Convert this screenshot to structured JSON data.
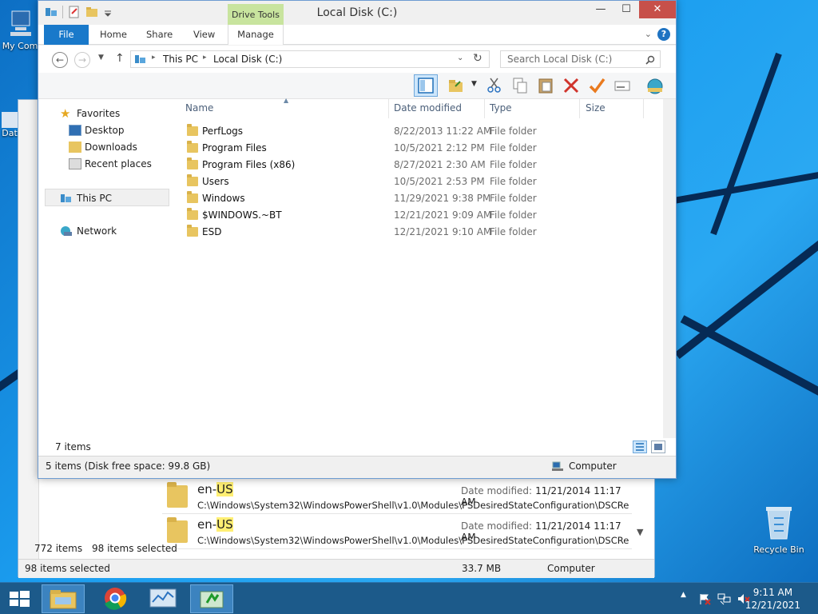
{
  "desktop": {
    "icons": [
      {
        "label": "My Com"
      },
      {
        "label": "Dat"
      },
      {
        "label": "Recycle Bin"
      }
    ]
  },
  "background_window": {
    "results": [
      {
        "name_prefix": "en-",
        "name_highlight": "US",
        "date_label": "Date modified:",
        "date": "11/21/2014 11:17 AM",
        "path": "C:\\Windows\\System32\\WindowsPowerShell\\v1.0\\Modules\\PSDesiredStateConfiguration\\DSCResour..."
      },
      {
        "name_prefix": "en-",
        "name_highlight": "US",
        "date_label": "Date modified:",
        "date": "11/21/2014 11:17 AM",
        "path": "C:\\Windows\\System32\\WindowsPowerShell\\v1.0\\Modules\\PSDesiredStateConfiguration\\DSCResour..."
      }
    ],
    "items_count": "772 items",
    "items_selected": "98 items selected",
    "status_selected": "98 items selected",
    "status_size": "33.7 MB",
    "status_location": "Computer"
  },
  "window": {
    "title": "Local Disk (C:)",
    "context_tab": "Drive Tools",
    "tabs": {
      "file": "File",
      "home": "Home",
      "share": "Share",
      "view": "View",
      "manage": "Manage"
    },
    "controls": {
      "minimize": "—",
      "maximize": "☐",
      "close": "✕"
    },
    "breadcrumbs": [
      "This PC",
      "Local Disk (C:)"
    ],
    "search_placeholder": "Search Local Disk (C:)",
    "nav": {
      "favorites": "Favorites",
      "desktop": "Desktop",
      "downloads": "Downloads",
      "recent": "Recent places",
      "this_pc": "This PC",
      "network": "Network"
    },
    "columns": {
      "name": "Name",
      "date": "Date modified",
      "type": "Type",
      "size": "Size"
    },
    "files": [
      {
        "name": "PerfLogs",
        "date": "8/22/2013 11:22 AM",
        "type": "File folder"
      },
      {
        "name": "Program Files",
        "date": "10/5/2021 2:12 PM",
        "type": "File folder"
      },
      {
        "name": "Program Files (x86)",
        "date": "8/27/2021 2:30 AM",
        "type": "File folder"
      },
      {
        "name": "Users",
        "date": "10/5/2021 2:53 PM",
        "type": "File folder"
      },
      {
        "name": "Windows",
        "date": "11/29/2021 9:38 PM",
        "type": "File folder"
      },
      {
        "name": "$WINDOWS.~BT",
        "date": "12/21/2021 9:09 AM",
        "type": "File folder"
      },
      {
        "name": "ESD",
        "date": "12/21/2021 9:10 AM",
        "type": "File folder"
      }
    ],
    "item_count": "7 items",
    "status_text": "5 items (Disk free space: 99.8 GB)",
    "status_location": "Computer"
  },
  "taskbar": {
    "clock_time": "9:11 AM",
    "clock_date": "12/21/2021"
  },
  "colors": {
    "accent": "#1979ca",
    "context_tab": "#c8e49e",
    "close": "#c7504a",
    "folder": "#e8c560"
  }
}
